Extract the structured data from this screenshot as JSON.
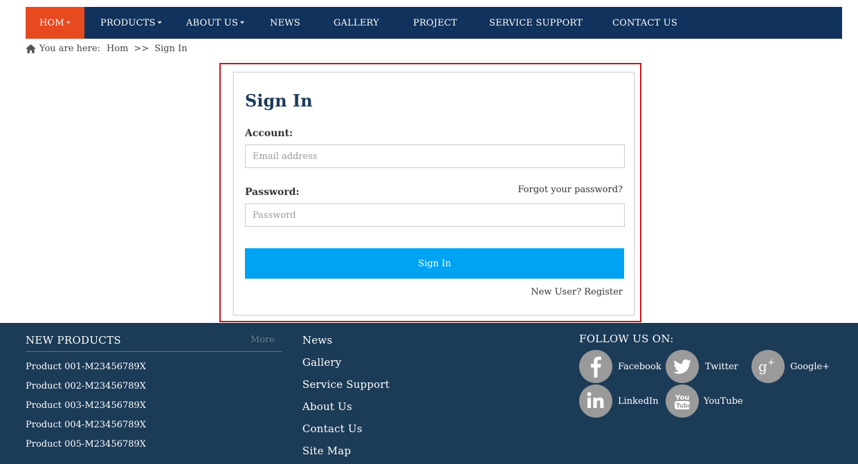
{
  "nav": {
    "items": [
      {
        "label": "HOM",
        "caret": true,
        "active": true
      },
      {
        "label": "PRODUCTS",
        "caret": true,
        "active": false
      },
      {
        "label": "ABOUT US",
        "caret": true,
        "active": false
      },
      {
        "label": "NEWS",
        "caret": false,
        "active": false
      },
      {
        "label": "GALLERY",
        "caret": false,
        "active": false
      },
      {
        "label": "PROJECT",
        "caret": false,
        "active": false
      },
      {
        "label": "SERVICE SUPPORT",
        "caret": false,
        "active": false
      },
      {
        "label": "CONTACT US",
        "caret": false,
        "active": false
      }
    ],
    "caret_glyph": "❤",
    "colors": {
      "bar": "#10325c",
      "active": "#e64a1e"
    }
  },
  "breadcrumb": {
    "prefix": "You are here:",
    "home": "Hom",
    "separator": ">>",
    "current": "Sign In"
  },
  "signin": {
    "title": "Sign In",
    "account_label": "Account:",
    "email_placeholder": "Email address",
    "password_label": "Password:",
    "forgot_label": "Forgot your password?",
    "password_placeholder": "Password",
    "button_label": "Sign In",
    "register_label": "New User? Register",
    "colors": {
      "button": "#00a3f2",
      "highlight_border": "#c4161c"
    }
  },
  "footer": {
    "new_products": {
      "title": "NEW PRODUCTS",
      "more": "More",
      "items": [
        "Product 001-M23456789X",
        "Product 002-M23456789X",
        "Product 003-M23456789X",
        "Product 004-M23456789X",
        "Product 005-M23456789X"
      ]
    },
    "links": [
      "News",
      "Gallery",
      "Service Support",
      "About Us",
      "Contact Us",
      "Site Map"
    ],
    "follow": {
      "title": "FOLLOW US ON:",
      "items": [
        {
          "label": "Facebook",
          "icon": "facebook-icon"
        },
        {
          "label": "Twitter",
          "icon": "twitter-icon"
        },
        {
          "label": "Google+",
          "icon": "google-plus-icon"
        },
        {
          "label": "LinkedIn",
          "icon": "linkedin-icon"
        },
        {
          "label": "YouTube",
          "icon": "youtube-icon"
        }
      ]
    },
    "colors": {
      "background": "#1c3b57"
    }
  }
}
